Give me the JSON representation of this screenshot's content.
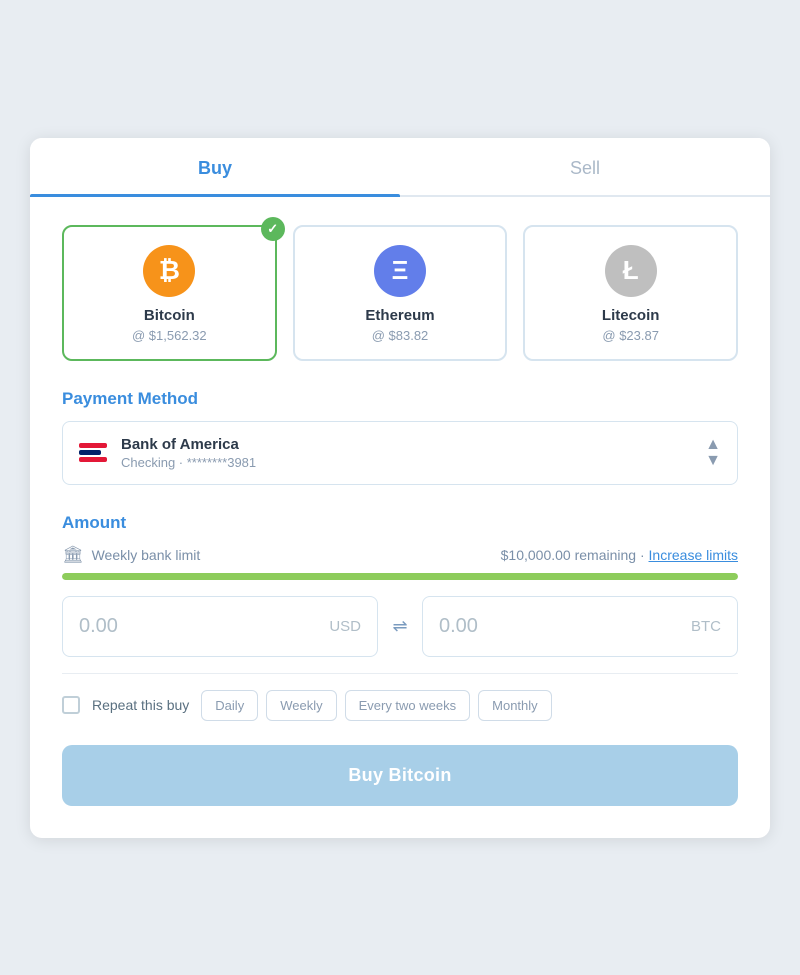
{
  "tabs": [
    {
      "id": "buy",
      "label": "Buy",
      "active": true
    },
    {
      "id": "sell",
      "label": "Sell",
      "active": false
    }
  ],
  "cryptos": [
    {
      "id": "btc",
      "name": "Bitcoin",
      "price": "@ $1,562.32",
      "symbol": "₿",
      "colorClass": "btc",
      "selected": true
    },
    {
      "id": "eth",
      "name": "Ethereum",
      "price": "@ $83.82",
      "symbol": "Ξ",
      "colorClass": "eth",
      "selected": false
    },
    {
      "id": "ltc",
      "name": "Litecoin",
      "price": "@ $23.87",
      "symbol": "Ł",
      "colorClass": "ltc",
      "selected": false
    }
  ],
  "payment_section_label": "Payment Method",
  "payment": {
    "bank_name": "Bank of America",
    "bank_sub": "Checking · ********3981"
  },
  "amount_section_label": "Amount",
  "limit": {
    "icon": "🏛",
    "label": "Weekly bank limit",
    "remaining": "$10,000.00 remaining",
    "separator": "·",
    "link_label": "Increase limits"
  },
  "progress": {
    "percent": 100
  },
  "usd_field": {
    "value": "0.00",
    "currency": "USD"
  },
  "btc_field": {
    "value": "0.00",
    "currency": "BTC"
  },
  "swap_icon": "⇌",
  "repeat": {
    "label": "Repeat this buy",
    "frequencies": [
      "Daily",
      "Weekly",
      "Every two weeks",
      "Monthly"
    ]
  },
  "buy_button_label": "Buy Bitcoin"
}
